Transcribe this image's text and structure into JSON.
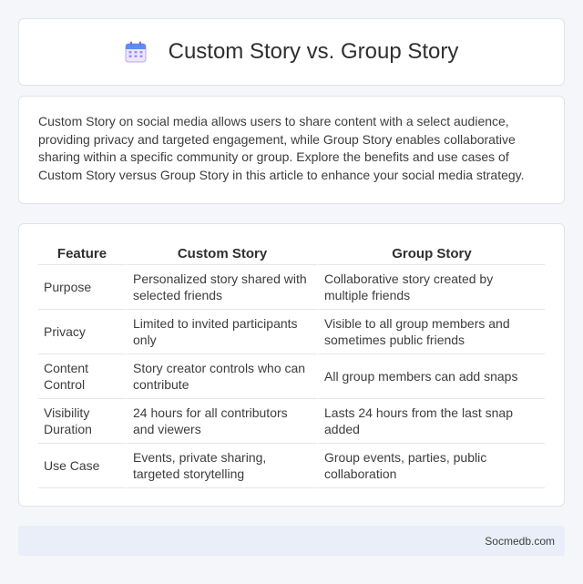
{
  "header": {
    "title": "Custom Story vs. Group Story",
    "icon": "calendar-icon"
  },
  "intro": {
    "text": "Custom Story on social media allows users to share content with a select audience, providing privacy and targeted engagement, while Group Story enables collaborative sharing within a specific community or group. Explore the benefits and use cases of Custom Story versus Group Story in this article to enhance your social media strategy."
  },
  "table": {
    "headers": [
      "Feature",
      "Custom Story",
      "Group Story"
    ],
    "rows": [
      [
        "Purpose",
        "Personalized story shared with selected friends",
        "Collaborative story created by multiple friends"
      ],
      [
        "Privacy",
        "Limited to invited participants only",
        "Visible to all group members and sometimes public friends"
      ],
      [
        "Content Control",
        "Story creator controls who can contribute",
        "All group members can add snaps"
      ],
      [
        "Visibility Duration",
        "24 hours for all contributors and viewers",
        "Lasts 24 hours from the last snap added"
      ],
      [
        "Use Case",
        "Events, private sharing, targeted storytelling",
        "Group events, parties, public collaboration"
      ]
    ]
  },
  "footer": {
    "site": "Socmedb.com"
  }
}
